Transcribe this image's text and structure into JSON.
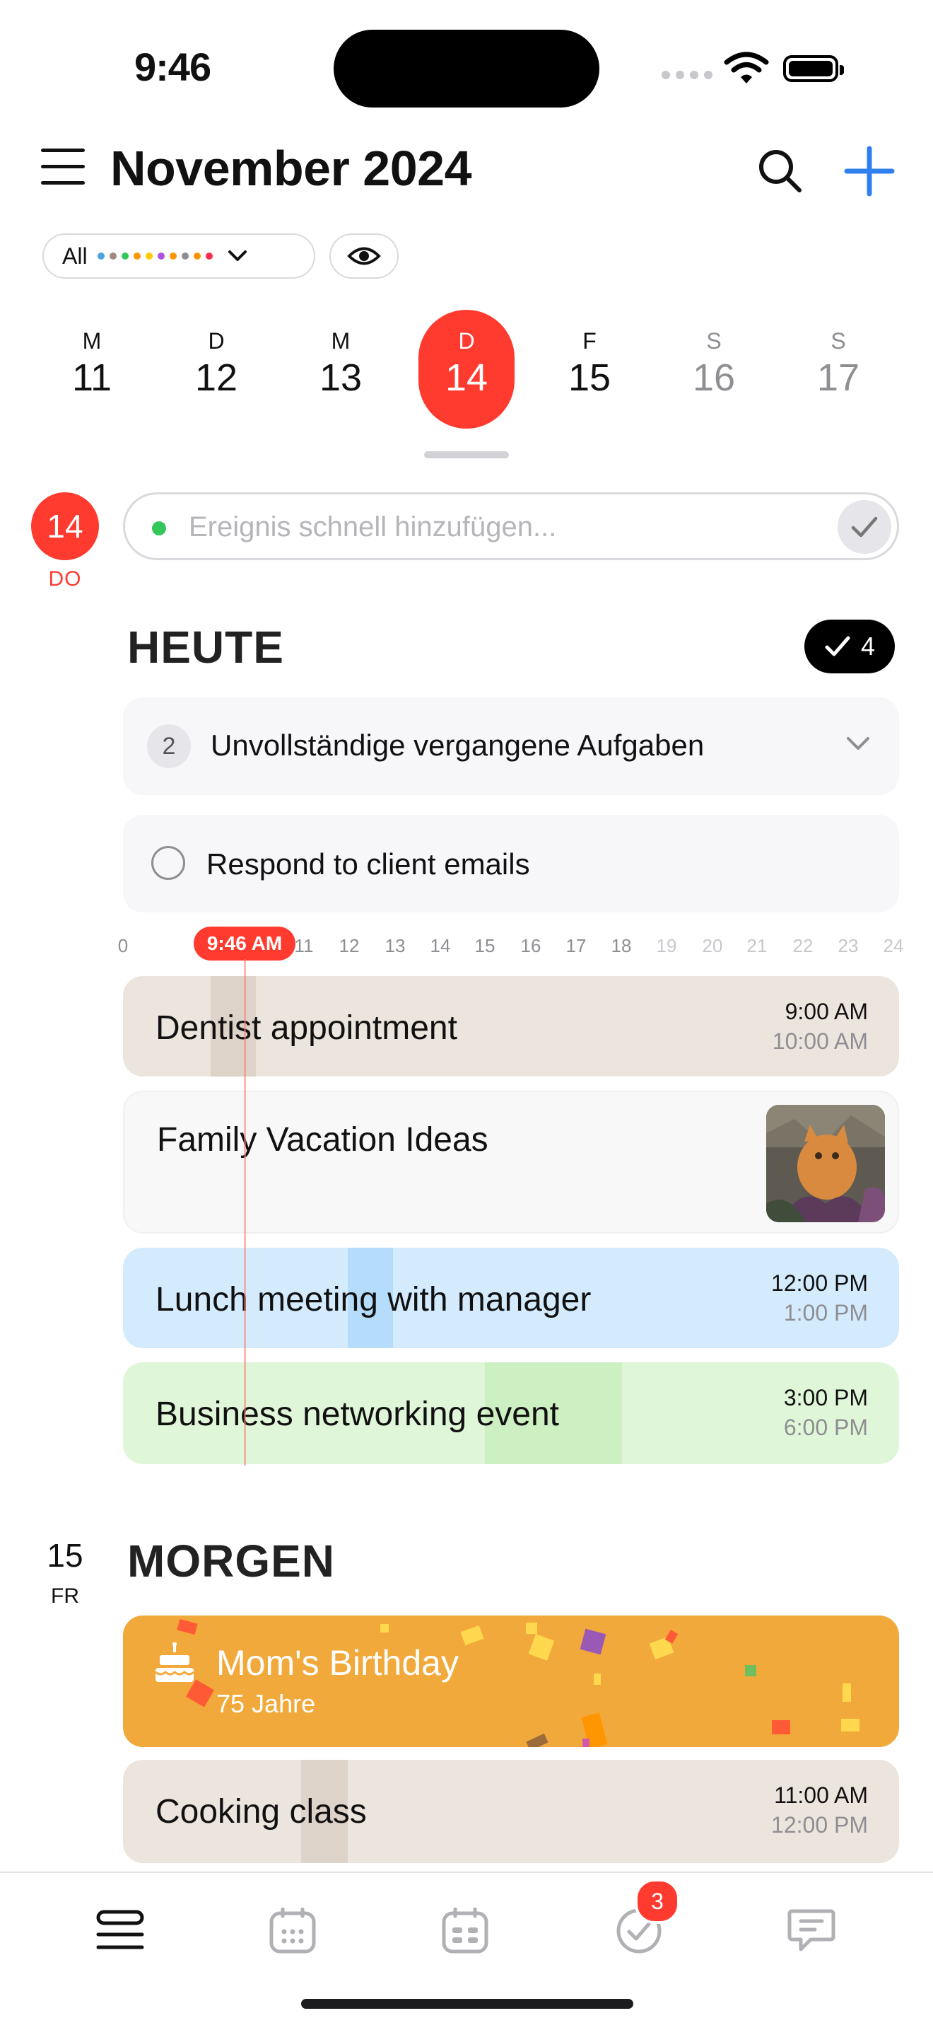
{
  "status_bar": {
    "time": "9:46"
  },
  "header": {
    "title": "November 2024"
  },
  "filter": {
    "label": "All",
    "dot_colors": [
      "#4aa3df",
      "#a1887f",
      "#34c759",
      "#ff9500",
      "#ffcc00",
      "#af52de",
      "#ff9500",
      "#8e8e93",
      "#ff9500",
      "#ff2d55"
    ]
  },
  "week": [
    {
      "wd": "M",
      "day": "11"
    },
    {
      "wd": "D",
      "day": "12"
    },
    {
      "wd": "M",
      "day": "13"
    },
    {
      "wd": "D",
      "day": "14"
    },
    {
      "wd": "F",
      "day": "15"
    },
    {
      "wd": "S",
      "day": "16"
    },
    {
      "wd": "S",
      "day": "17"
    }
  ],
  "today": {
    "date": "14",
    "dow": "DO",
    "quick_add_placeholder": "Ereignis schnell hinzufügen...",
    "section_title": "HEUTE",
    "task_count": "4",
    "past_tasks": {
      "count": "2",
      "label": "Unvollständige vergangene Aufgaben"
    },
    "task": "Respond to client emails",
    "now_label": "9:46 AM",
    "ruler_ticks": [
      "0",
      "11",
      "12",
      "13",
      "14",
      "15",
      "16",
      "17",
      "18",
      "19",
      "20",
      "21",
      "22",
      "23",
      "24"
    ],
    "events": [
      {
        "name": "Dentist appointment",
        "start": "9:00 AM",
        "end": "10:00 AM"
      },
      {
        "name": "Family Vacation Ideas"
      },
      {
        "name": "Lunch meeting with manager",
        "start": "12:00 PM",
        "end": "1:00 PM"
      },
      {
        "name": "Business networking event",
        "start": "3:00 PM",
        "end": "6:00 PM"
      }
    ]
  },
  "tomorrow": {
    "date": "15",
    "dow": "FR",
    "section_title": "MORGEN",
    "birthday": {
      "name": "Mom's Birthday",
      "sub": "75 Jahre"
    },
    "events": [
      {
        "name": "Cooking class",
        "start": "11:00 AM",
        "end": "12:00 PM"
      }
    ]
  },
  "tabbar": {
    "items": [
      "agenda-icon",
      "month-calendar-icon",
      "week-calendar-icon",
      "tasks-icon",
      "chat-icon"
    ],
    "badge": "3"
  },
  "colors": {
    "accent": "#ff3b30",
    "add": "#2f80ed",
    "birthday": "#f2a93b"
  }
}
